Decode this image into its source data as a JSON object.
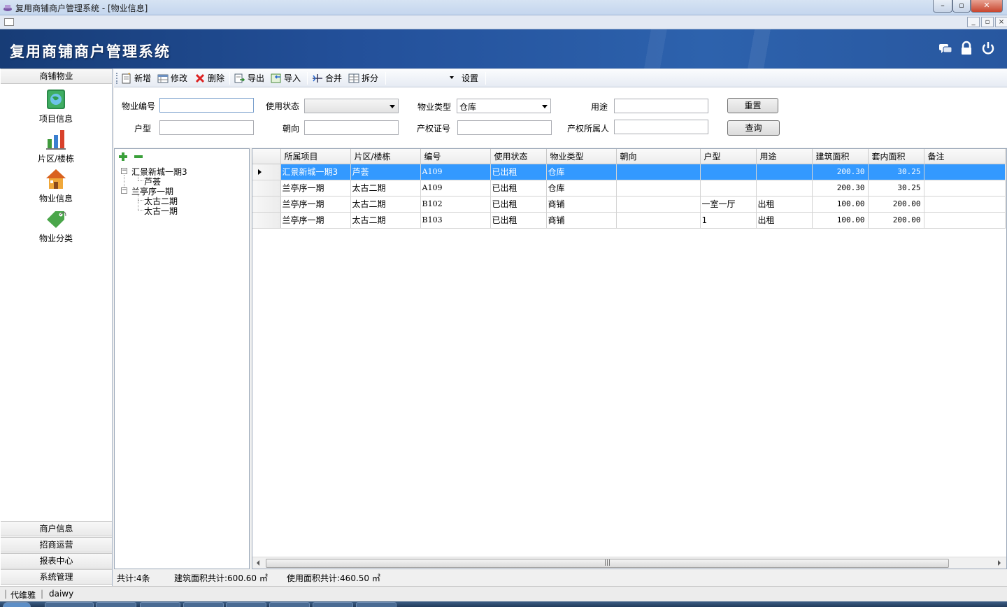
{
  "window": {
    "title": "复用商铺商户管理系统 - [物业信息]",
    "controls": [
      "minimize",
      "maximize",
      "close"
    ]
  },
  "header": {
    "app_title": "复用商铺商户管理系统",
    "icons": [
      "messages-icon",
      "lock-icon",
      "power-icon"
    ]
  },
  "sidebar": {
    "top_section": "商铺物业",
    "items": [
      {
        "label": "项目信息",
        "icon": "globe-book-icon"
      },
      {
        "label": "片区/楼栋",
        "icon": "bar-chart-icon"
      },
      {
        "label": "物业信息",
        "icon": "house-icon"
      },
      {
        "label": "物业分类",
        "icon": "tag-icon"
      }
    ],
    "bottom_sections": [
      "商户信息",
      "招商运营",
      "报表中心",
      "系统管理"
    ]
  },
  "toolbar": {
    "new": "新增",
    "edit": "修改",
    "delete": "删除",
    "export": "导出",
    "import": "导入",
    "merge": "合并",
    "split": "拆分",
    "settings": "设置"
  },
  "search": {
    "property_no_label": "物业编号",
    "property_no_value": "",
    "use_status_label": "使用状态",
    "use_status_value": "",
    "property_type_label": "物业类型",
    "property_type_value": "仓库",
    "purpose_label": "用途",
    "purpose_value": "",
    "unit_type_label": "户型",
    "unit_type_value": "",
    "orientation_label": "朝向",
    "orientation_value": "",
    "cert_no_label": "产权证号",
    "cert_no_value": "",
    "owner_label": "产权所属人",
    "owner_value": "",
    "reset_button": "重置",
    "query_button": "查询"
  },
  "tree": {
    "nodes": [
      {
        "label": "汇景新城一期3",
        "children": [
          "芦荟"
        ]
      },
      {
        "label": "兰亭序一期",
        "children": [
          "太古二期",
          "太古一期"
        ]
      }
    ]
  },
  "grid": {
    "columns": [
      "所属项目",
      "片区/楼栋",
      "编号",
      "使用状态",
      "物业类型",
      "朝向",
      "户型",
      "用途",
      "建筑面积",
      "套内面积",
      "备注"
    ],
    "rows": [
      [
        "汇景新城一期3",
        "芦荟",
        "A109",
        "已出租",
        "仓库",
        "",
        "",
        "",
        "200.30",
        "30.25",
        ""
      ],
      [
        "兰亭序一期",
        "太古二期",
        "A109",
        "已出租",
        "仓库",
        "",
        "",
        "",
        "200.30",
        "30.25",
        ""
      ],
      [
        "兰亭序一期",
        "太古二期",
        "B102",
        "已出租",
        "商铺",
        "",
        "一室一厅",
        "出租",
        "100.00",
        "200.00",
        ""
      ],
      [
        "兰亭序一期",
        "太古二期",
        "B103",
        "已出租",
        "商铺",
        "",
        "1",
        "出租",
        "100.00",
        "200.00",
        ""
      ]
    ],
    "selected_row": 0
  },
  "summary": {
    "count": "共计:4条",
    "building_area": "建筑面积共计:600.60 ㎡",
    "use_area": "使用面积共计:460.50 ㎡"
  },
  "statusbar": {
    "user_name": "代维雅",
    "user_id": "daiwy"
  },
  "colors": {
    "banner": "#23509a",
    "selection": "#3399ff"
  }
}
